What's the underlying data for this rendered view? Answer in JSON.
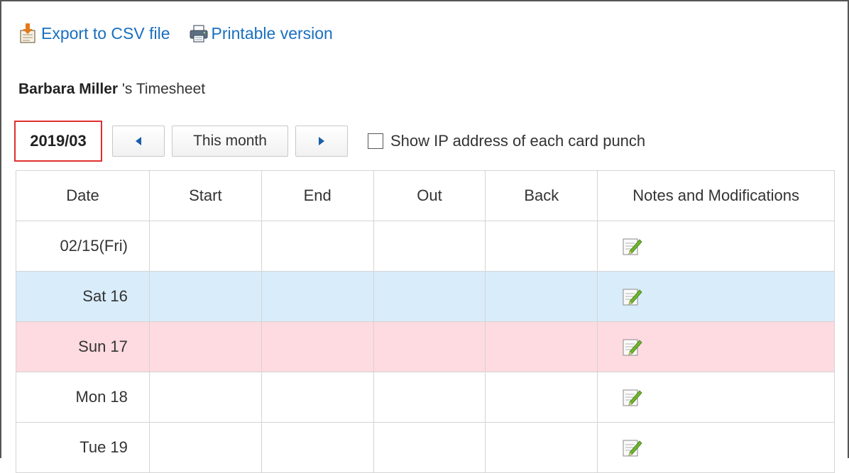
{
  "toolbar": {
    "export_label": "Export to CSV file",
    "print_label": "Printable version"
  },
  "header": {
    "user_name": "Barbara Miller",
    "title_suffix": " 's Timesheet"
  },
  "controls": {
    "current_month": "2019/03",
    "this_month_label": "This month",
    "show_ip_label": "Show IP address of each card punch",
    "show_ip_checked": false
  },
  "table": {
    "headers": [
      "Date",
      "Start",
      "End",
      "Out",
      "Back",
      "Notes and Modifications"
    ],
    "rows": [
      {
        "date": "02/15(Fri)",
        "start": "",
        "end": "",
        "out": "",
        "back": "",
        "type": "weekday"
      },
      {
        "date": "Sat 16",
        "start": "",
        "end": "",
        "out": "",
        "back": "",
        "type": "saturday"
      },
      {
        "date": "Sun 17",
        "start": "",
        "end": "",
        "out": "",
        "back": "",
        "type": "sunday"
      },
      {
        "date": "Mon 18",
        "start": "",
        "end": "",
        "out": "",
        "back": "",
        "type": "weekday"
      },
      {
        "date": "Tue 19",
        "start": "",
        "end": "",
        "out": "",
        "back": "",
        "type": "weekday"
      }
    ]
  },
  "icons": {
    "export": "export-csv-icon",
    "print": "printer-icon",
    "prev": "previous-month-arrow-icon",
    "next": "next-month-arrow-icon",
    "edit": "edit-note-icon"
  },
  "colors": {
    "link": "#1a6fbf",
    "saturday_row": "#d9ecfa",
    "sunday_row": "#fddbe0",
    "month_highlight_border": "#e03030"
  }
}
